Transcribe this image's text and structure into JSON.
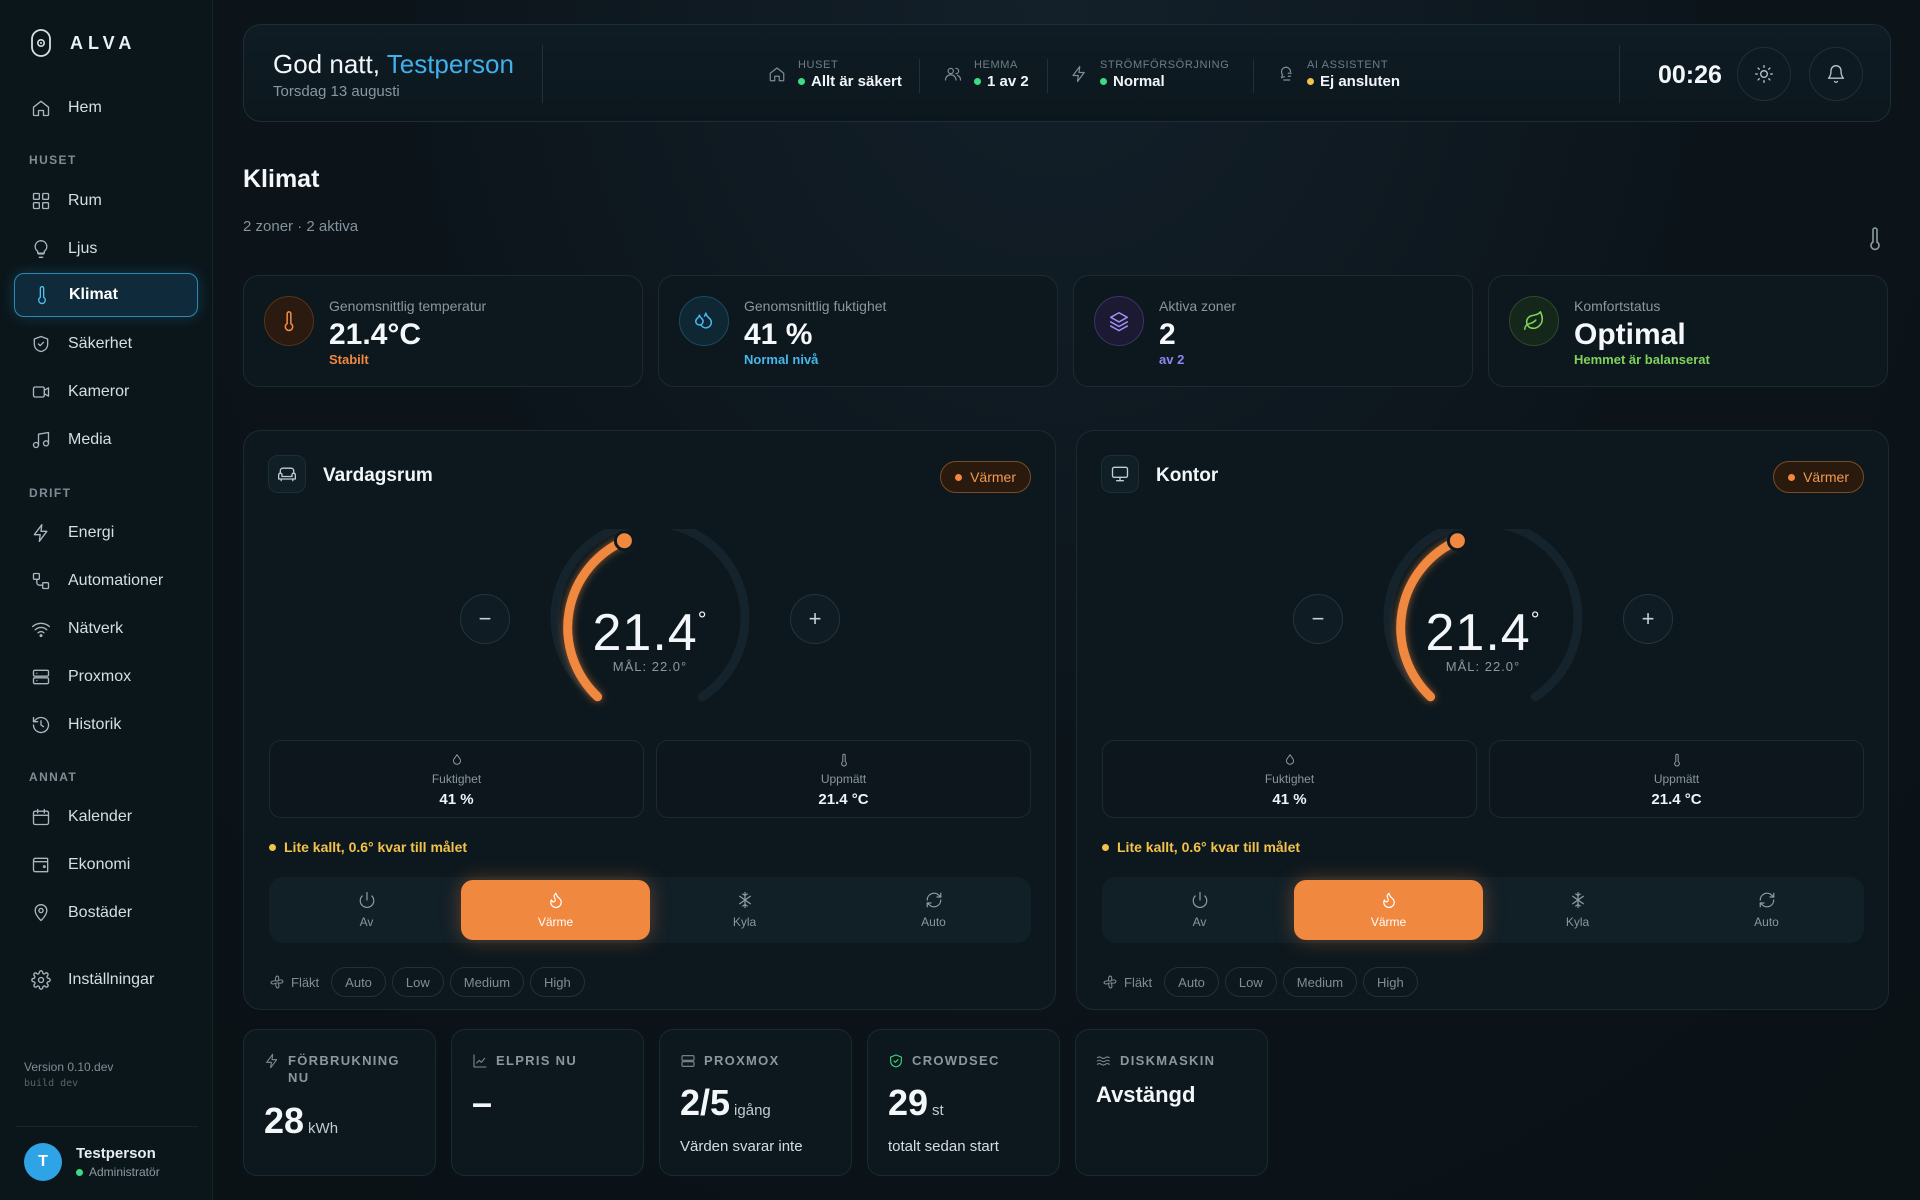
{
  "brand": {
    "name": "ALVA"
  },
  "sidebar": {
    "home": "Hem",
    "section_house": "HUSET",
    "house_items": [
      "Rum",
      "Ljus",
      "Klimat",
      "Säkerhet",
      "Kameror",
      "Media"
    ],
    "section_ops": "DRIFT",
    "ops_items": [
      "Energi",
      "Automationer",
      "Nätverk",
      "Proxmox",
      "Historik"
    ],
    "section_other": "ANNAT",
    "other_items": [
      "Kalender",
      "Ekonomi",
      "Bostäder"
    ],
    "settings": "Inställningar",
    "active_item": "Klimat",
    "version": "Version 0.10.dev",
    "build": "build dev",
    "user": {
      "initial": "T",
      "name": "Testperson",
      "role": "Administratör"
    }
  },
  "header": {
    "greeting": "God natt,",
    "name": "Testperson",
    "date": "Torsdag 13 augusti",
    "stats": [
      {
        "label": "HUSET",
        "value": "Allt är säkert",
        "status_color": "#3ddc84",
        "icon": "house-icon"
      },
      {
        "label": "HEMMA",
        "value": "1 av 2",
        "status_color": "#3ddc84",
        "icon": "users-icon"
      },
      {
        "label": "STRÖMFÖRSÖRJNING",
        "value": "Normal",
        "status_color": "#3ddc84",
        "icon": "bolt-icon"
      },
      {
        "label": "AI ASSISTENT",
        "value": "Ej ansluten",
        "status_color": "#f3c24a",
        "icon": "ai-icon"
      }
    ],
    "clock": "00:26"
  },
  "page": {
    "title": "Klimat",
    "subtitle": "2 zoner · 2 aktiva"
  },
  "summary": [
    {
      "label": "Genomsnittlig temperatur",
      "value": "21.4°C",
      "sub": "Stabilt",
      "sub_color": "#f0883f",
      "icon": "thermometer-icon"
    },
    {
      "label": "Genomsnittlig fuktighet",
      "value": "41 %",
      "sub": "Normal nivå",
      "sub_color": "#46b7ec",
      "icon": "droplets-icon"
    },
    {
      "label": "Aktiva zoner",
      "value": "2",
      "sub": "av 2",
      "sub_color": "#8f86f0",
      "icon": "layers-icon"
    },
    {
      "label": "Komfortstatus",
      "value": "Optimal",
      "sub": "Hemmet är balanserat",
      "sub_color": "#7ed35a",
      "icon": "leaf-icon"
    }
  ],
  "zones": [
    {
      "name": "Vardagsrum",
      "icon": "sofa-icon",
      "badge": "Värmer",
      "temp": "21.4",
      "target": "MÅL: 22.0°",
      "humidity_label": "Fuktighet",
      "humidity": "41 %",
      "measured_label": "Uppmätt",
      "measured": "21.4 °C",
      "warning": "Lite kallt, 0.6° kvar till målet",
      "modes": [
        "Av",
        "Värme",
        "Kyla",
        "Auto"
      ],
      "active_mode": "Värme",
      "fan_label": "Fläkt",
      "fan_options": [
        "Auto",
        "Low",
        "Medium",
        "High"
      ]
    },
    {
      "name": "Kontor",
      "icon": "monitor-icon",
      "badge": "Värmer",
      "temp": "21.4",
      "target": "MÅL: 22.0°",
      "humidity_label": "Fuktighet",
      "humidity": "41 %",
      "measured_label": "Uppmätt",
      "measured": "21.4 °C",
      "warning": "Lite kallt, 0.6° kvar till målet",
      "modes": [
        "Av",
        "Värme",
        "Kyla",
        "Auto"
      ],
      "active_mode": "Värme",
      "fan_label": "Fläkt",
      "fan_options": [
        "Auto",
        "Low",
        "Medium",
        "High"
      ]
    }
  ],
  "widgets": [
    {
      "title": "FÖRBRUKNING NU",
      "value": "28",
      "unit": "kWh",
      "sub": "",
      "icon": "bolt-icon"
    },
    {
      "title": "ELPRIS NU",
      "value": "–",
      "unit": "",
      "sub": "",
      "icon": "chart-icon"
    },
    {
      "title": "PROXMOX",
      "value": "2/5",
      "unit": "igång",
      "sub": "Värden svarar inte",
      "icon": "server-icon"
    },
    {
      "title": "CROWDSEC",
      "value": "29",
      "unit": "st",
      "sub": "totalt sedan start",
      "icon": "shield-check-icon"
    },
    {
      "title": "DISKMASKIN",
      "value": "Avstängd",
      "unit": "",
      "sub": "",
      "icon": "waves-icon"
    }
  ],
  "colors": {
    "accent": "#3fb0ec",
    "heat": "#f0883f",
    "warning": "#f3c24a",
    "ok": "#3ddc84"
  }
}
